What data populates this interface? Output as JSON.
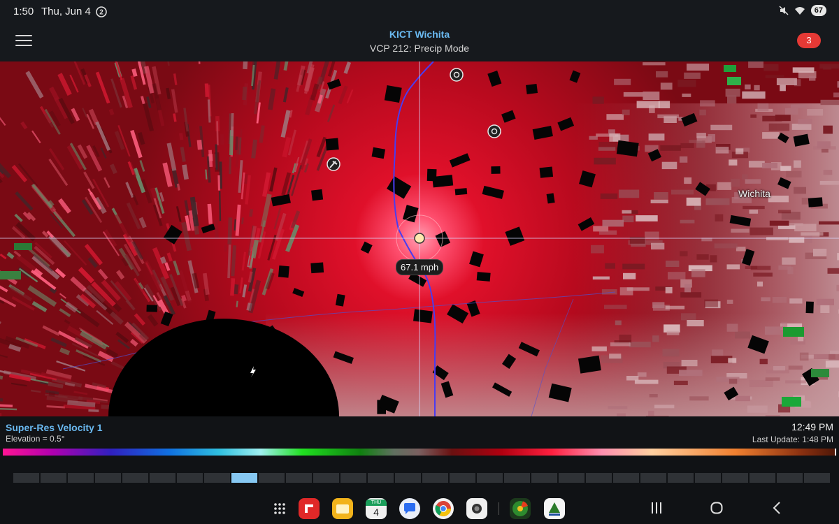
{
  "status_bar": {
    "time": "1:50",
    "date": "Thu, Jun 4",
    "battery": "67"
  },
  "header": {
    "title": "KICT Wichita",
    "subtitle": "VCP 212: Precip Mode",
    "alert_count": "3"
  },
  "radar": {
    "velocity_readout": "67.1 mph",
    "city_label": "Wichita"
  },
  "info": {
    "product_name": "Super-Res Velocity 1",
    "elevation": "Elevation = 0.5°",
    "scan_time": "12:49 PM",
    "last_update": "Last Update: 1:48 PM"
  },
  "loop": {
    "frame_count": 30,
    "active_frame": 8
  },
  "dock": {
    "calendar_day": "THU",
    "calendar_date": "4",
    "app_icons": [
      "flipboard-icon",
      "files-icon",
      "calendar-icon",
      "messages-icon",
      "chrome-icon",
      "camera-icon",
      "radar-app-icon",
      "kandrive-icon"
    ]
  },
  "colors": {
    "accent": "#6ab9f0",
    "alert": "#e53935",
    "active_frame": "#86c8f2"
  }
}
